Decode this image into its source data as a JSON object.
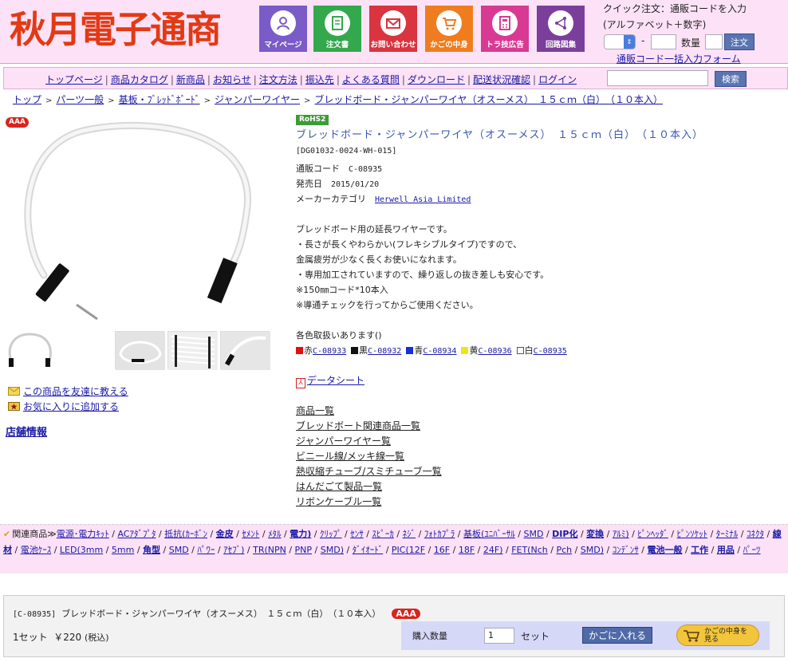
{
  "header": {
    "logo_text": "秋月電子通商",
    "nav": [
      {
        "label": "マイページ",
        "icon": "user-icon",
        "color": "#7a5bc8"
      },
      {
        "label": "注文書",
        "icon": "document-icon",
        "color": "#33a84d"
      },
      {
        "label": "お問い合わせ",
        "icon": "mail-icon",
        "color": "#d9343f"
      },
      {
        "label": "かごの中身",
        "icon": "cart-icon",
        "color": "#ef7d1f"
      },
      {
        "label": "トラ技広告",
        "icon": "calculator-icon",
        "color": "#d83a93"
      },
      {
        "label": "回路図集",
        "icon": "circuit-icon",
        "color": "#7b3f9b"
      }
    ],
    "quick_order": {
      "title": "クイック注文：通販コードを入力",
      "subtitle": "(アルファベット＋数字)",
      "separator": "-",
      "qty_label": "数量",
      "button": "注文",
      "bulk_link": "通販コード一括入力フォーム"
    }
  },
  "menu": {
    "items": [
      "トップページ",
      "商品カタログ",
      "新商品",
      "お知らせ",
      "注文方法",
      "振込先",
      "よくある質問",
      "ダウンロード",
      "配送状況確認",
      "ログイン"
    ],
    "search_button": "検索"
  },
  "breadcrumb": [
    "トップ",
    "パーツ一般",
    "基板・ﾌﾞﾚｯﾄﾞﾎﾞｰﾄﾞ",
    "ジャンパーワイヤー",
    "ブレッドボード・ジャンパーワイヤ（オスーメス）　１５ｃｍ（白）　（１０本入）"
  ],
  "badges": {
    "aaa": "AAA",
    "rohs": "RoHS2"
  },
  "product": {
    "title": "ブレッドボード・ジャンパーワイヤ（オスーメス）　１５ｃｍ（白）　（１０本入）",
    "model": "[DG01032-0024-WH-015]",
    "code_label": "通販コード",
    "code": "C-08935",
    "date_label": "発売日",
    "date": "2015/01/20",
    "maker_label": "メーカーカテゴリ",
    "maker": "Herwell Asia Limited",
    "description": [
      "ブレッドボード用の延長ワイヤーです。",
      "・長さが長くやわらかい(フレキシブルタイプ)ですので、",
      "金属疲労が少なく長くお使いになれます。",
      "・専用加工されていますので、繰り返しの抜き差しも安心です。",
      "※150㎜コード*10本入",
      "※導通チェックを行ってからご使用ください。"
    ],
    "colors_heading": "各色取扱いあります()",
    "colors": [
      {
        "name": "赤",
        "code": "C-08933",
        "color": "#e01010"
      },
      {
        "name": "黒",
        "code": "C-08932",
        "color": "#111111"
      },
      {
        "name": "青",
        "code": "C-08934",
        "color": "#1430d8"
      },
      {
        "name": "黄",
        "code": "C-08936",
        "color": "#f2e21a"
      },
      {
        "name": "白",
        "code": "C-08935",
        "color": "#ffffff"
      }
    ],
    "datasheet": "データシート",
    "links": [
      "商品一覧",
      "ブレッドボート関連商品一覧",
      "ジャンパーワイヤー覧",
      "ビニール線/メッキ線一覧",
      "熱収縮チューブ/スミチューブ一覧",
      "はんだごて製品一覧",
      "リボンケーブル一覧"
    ]
  },
  "sidebar": {
    "tell_friend": "この商品を友達に教える",
    "add_favorite": "お気に入りに追加する",
    "store_info": "店舗情報"
  },
  "related": {
    "label": "関連商品≫",
    "line1": [
      {
        "t": "電源･電力ｷｯﾄ",
        "b": false
      },
      {
        "t": "ACｱﾀﾞﾌﾟﾀ",
        "b": false
      },
      {
        "t": "抵抗(ｶｰﾎﾞﾝ",
        "b": false
      },
      {
        "t": "金皮",
        "b": true
      },
      {
        "t": "ｾﾒﾝﾄ",
        "b": false
      },
      {
        "t": "ﾒﾀﾙ",
        "b": false
      },
      {
        "t": "電力)",
        "b": true
      },
      {
        "t": "ｸﾘｯﾌﾟ",
        "b": false
      },
      {
        "t": "ｾﾝｻ",
        "b": false
      },
      {
        "t": "ｽﾋﾟｰｶ",
        "b": false
      },
      {
        "t": "ﾈｼﾞ",
        "b": false
      },
      {
        "t": "ﾌｫﾄｶﾌﾟﾗ",
        "b": false
      },
      {
        "t": "基板(ﾕﾆﾊﾞｰｻﾙ",
        "b": false
      },
      {
        "t": "SMD",
        "b": false
      },
      {
        "t": "DIP化",
        "b": true
      },
      {
        "t": "変換",
        "b": true
      },
      {
        "t": "ｱﾙﾐ)",
        "b": false
      },
      {
        "t": "ﾋﾟﾝﾍｯﾀﾞ",
        "b": false
      },
      {
        "t": "ﾋﾟﾝｿｹｯﾄ",
        "b": false
      }
    ],
    "line2": [
      {
        "t": "ﾀｰﾐﾅﾙ",
        "b": false
      },
      {
        "t": "ｺﾈｸﾀ",
        "b": false
      },
      {
        "t": "線材",
        "b": true
      },
      {
        "t": "電池ｹｰｽ",
        "b": false
      },
      {
        "t": "LED(3mm",
        "b": false
      },
      {
        "t": "5mm",
        "b": false
      },
      {
        "t": "角型",
        "b": true
      },
      {
        "t": "SMD",
        "b": false
      },
      {
        "t": "ﾊﾟﾜｰ",
        "b": false
      },
      {
        "t": "ｱｾﾌﾞ)",
        "b": false
      },
      {
        "t": "TR(NPN",
        "b": false
      },
      {
        "t": "PNP",
        "b": false
      },
      {
        "t": "SMD)",
        "b": false
      },
      {
        "t": "ﾀﾞｲｵｰﾄﾞ",
        "b": false
      },
      {
        "t": "PIC(12F",
        "b": false
      },
      {
        "t": "16F",
        "b": false
      },
      {
        "t": "18F",
        "b": false
      },
      {
        "t": "24F)",
        "b": false
      },
      {
        "t": "FET(Nch",
        "b": false
      },
      {
        "t": "Pch",
        "b": false
      },
      {
        "t": "SMD)",
        "b": false
      },
      {
        "t": "ｺﾝﾃﾞﾝｻ",
        "b": false
      },
      {
        "t": "電池一般",
        "b": true
      },
      {
        "t": "工作",
        "b": true
      }
    ],
    "line3": [
      {
        "t": "用品",
        "b": true
      },
      {
        "t": "ﾊﾟｰﾂ",
        "b": false
      }
    ]
  },
  "order": {
    "code_bracket": "[C-08935]",
    "title": "ブレッドボード・ジャンパーワイヤ（オスーメス）　１５ｃｍ（白）　（１０本入）",
    "unit": "1セット",
    "price": "￥220",
    "tax": "(税込)",
    "qty_label": "購入数量",
    "qty_value": "1",
    "qty_unit": "セット",
    "add_cart": "かごに入れる",
    "view_cart": "かごの中身を見る"
  }
}
